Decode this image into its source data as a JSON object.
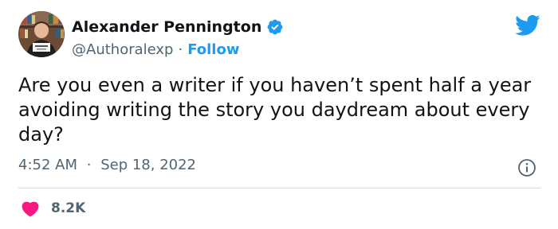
{
  "author": {
    "display_name": "Alexander Pennington",
    "handle": "@Authoralexp",
    "separator": "·",
    "follow_label": "Follow"
  },
  "tweet": {
    "text": "Are you even a writer if you haven’t spent half a year avoiding writing the story you daydream about every day?",
    "time": "4:52 AM",
    "date_separator": "·",
    "date": "Sep 18, 2022"
  },
  "engagement": {
    "likes": "8.2K"
  },
  "icons": {
    "verified": "verified-badge-icon",
    "logo": "twitter-bird-icon",
    "info": "info-icon",
    "like": "heart-icon"
  },
  "colors": {
    "accent": "#1d9bf0",
    "text": "#0f1419",
    "secondary_text": "#536471",
    "heart": "#f91880",
    "divider": "#cfd9de"
  }
}
